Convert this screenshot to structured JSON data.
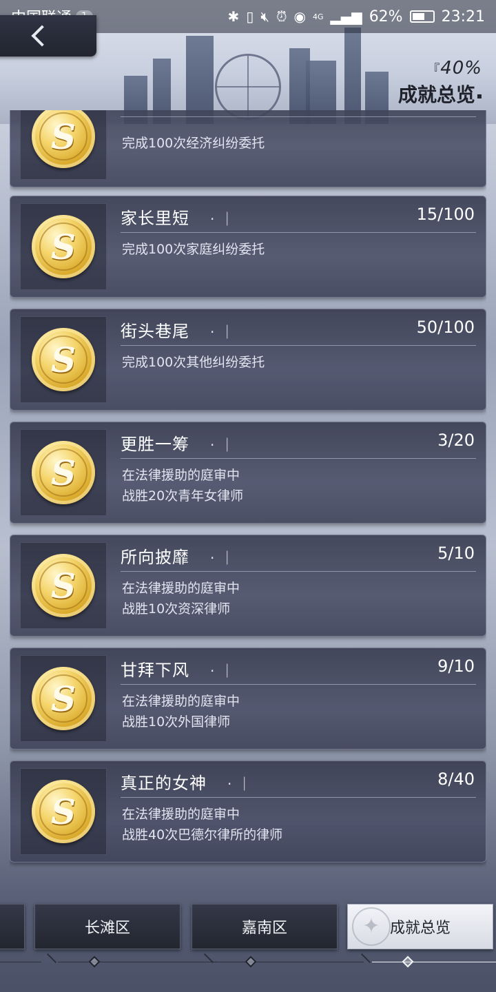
{
  "status_bar": {
    "carrier": "中国联通",
    "sim_slot": "1",
    "network": "4G",
    "battery": "62%",
    "battery_level": 0.62,
    "time": "23:21",
    "icons": [
      "bluetooth-icon",
      "vibrate-icon",
      "mute-icon",
      "alarm-icon",
      "eye-icon",
      "signal-icon"
    ]
  },
  "header": {
    "back_icon": "chevron-left-icon",
    "percent": "40%",
    "title": "成就总览"
  },
  "achievements": [
    {
      "title": "",
      "progress": "",
      "desc_line1": "完成100次经济纠纷委托",
      "desc_line2": ""
    },
    {
      "title": "家长里短",
      "progress": "15/100",
      "desc_line1": "完成100次家庭纠纷委托",
      "desc_line2": ""
    },
    {
      "title": "街头巷尾",
      "progress": "50/100",
      "desc_line1": "完成100次其他纠纷委托",
      "desc_line2": ""
    },
    {
      "title": "更胜一筹",
      "progress": "3/20",
      "desc_line1": "在法律援助的庭审中",
      "desc_line2": "战胜20次青年女律师"
    },
    {
      "title": "所向披靡",
      "progress": "5/10",
      "desc_line1": "在法律援助的庭审中",
      "desc_line2": "战胜10次资深律师"
    },
    {
      "title": "甘拜下风",
      "progress": "9/10",
      "desc_line1": "在法律援助的庭审中",
      "desc_line2": "战胜10次外国律师"
    },
    {
      "title": "真正的女神",
      "progress": "8/40",
      "desc_line1": "在法律援助的庭审中",
      "desc_line2": "战胜40次巴德尔律所的律师"
    }
  ],
  "coin_glyph": "S",
  "title_separator": "· ｜",
  "tabs": [
    {
      "label": ""
    },
    {
      "label": "长滩区"
    },
    {
      "label": "嘉南区"
    },
    {
      "label": "成就总览",
      "active": true
    }
  ],
  "colors": {
    "card_bg": "#464b63",
    "coin_gold": "#d9a92a",
    "active_tab": "#f3f4f8"
  }
}
